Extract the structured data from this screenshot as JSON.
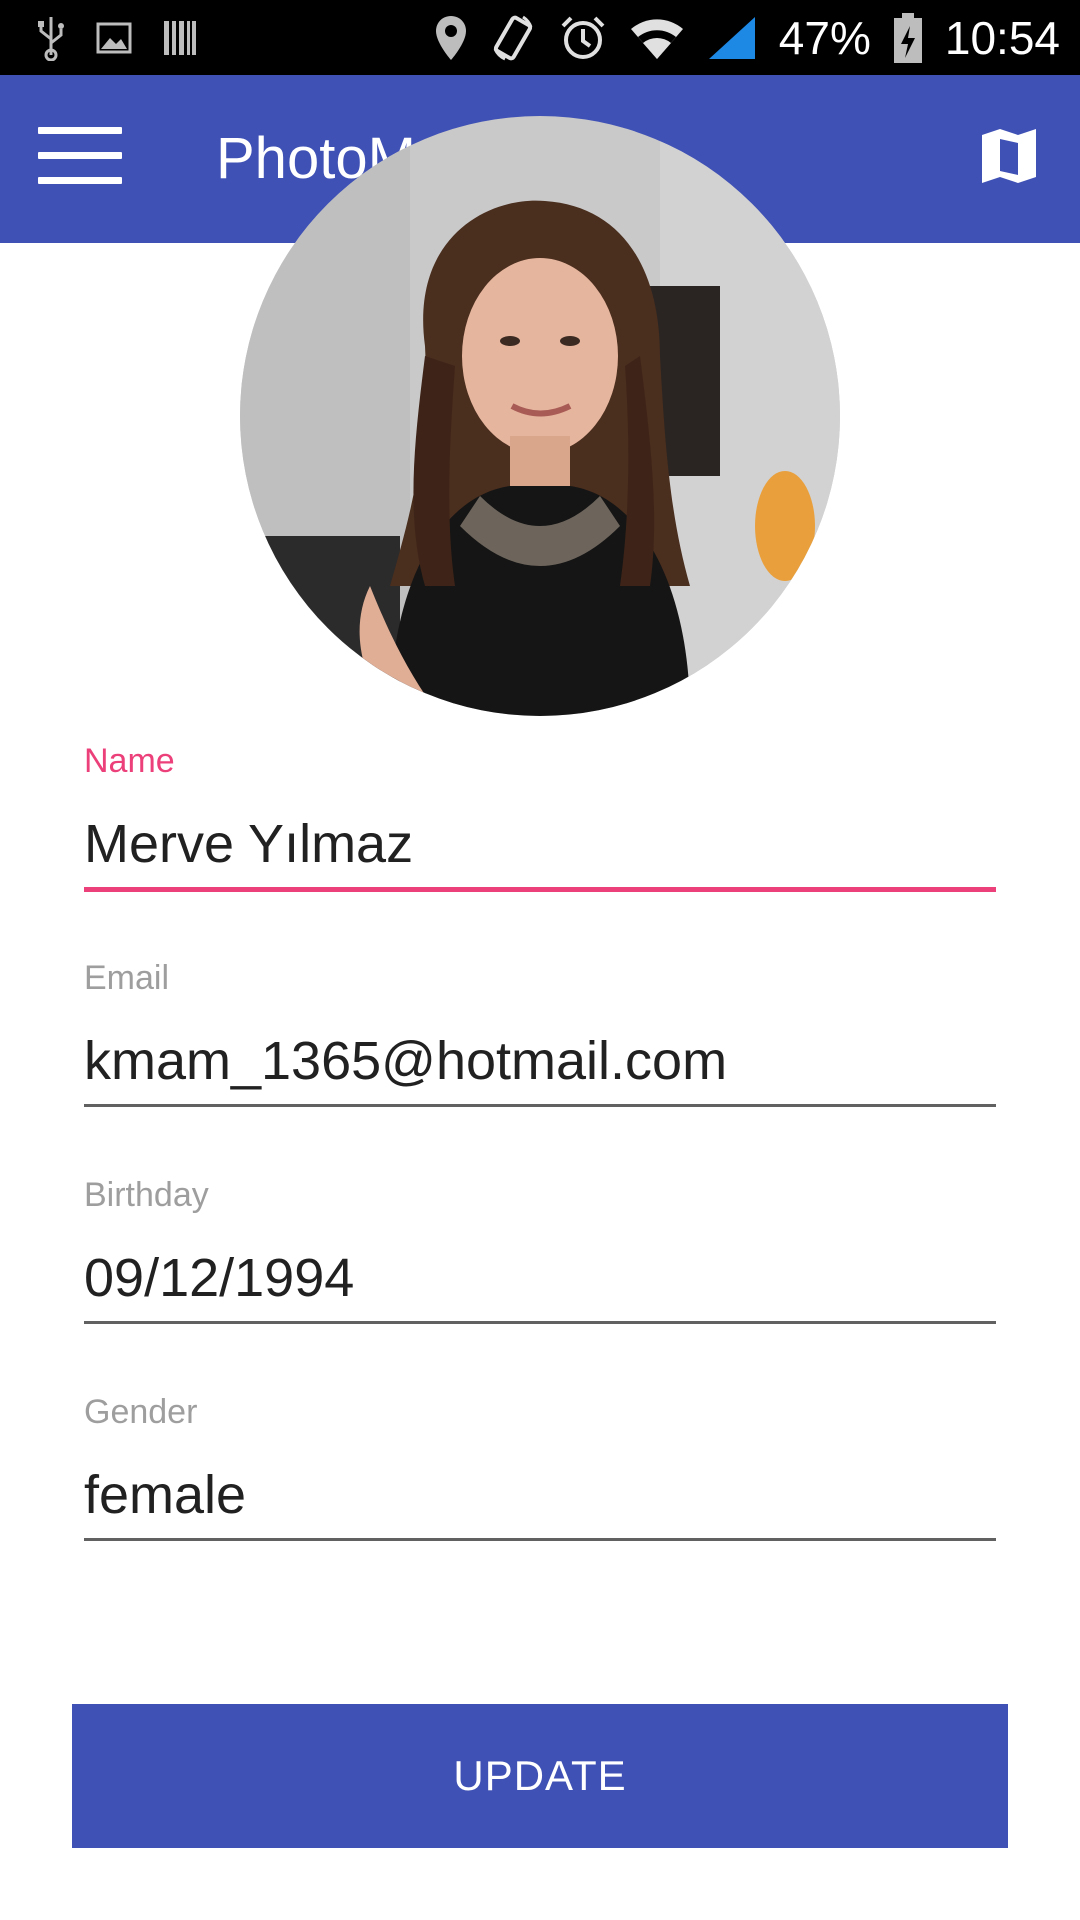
{
  "status_bar": {
    "battery_percent": "47%",
    "time": "10:54",
    "icons": [
      "usb-icon",
      "image-notification-icon",
      "barcode-icon",
      "location-pin-icon",
      "screen-rotation-icon",
      "alarm-icon",
      "wifi-icon",
      "cellular-signal-icon",
      "battery-charging-icon"
    ]
  },
  "app_bar": {
    "title": "PhotoMap",
    "menu_icon": "hamburger-menu-icon",
    "map_icon": "map-icon",
    "color": "#3f51b5"
  },
  "profile": {
    "avatar_icon": "profile-photo"
  },
  "form": {
    "fields": [
      {
        "label": "Name",
        "value": "Merve Yılmaz",
        "focused": true
      },
      {
        "label": "Email",
        "value": "kmam_1365@hotmail.com",
        "focused": false
      },
      {
        "label": "Birthday",
        "value": "09/12/1994",
        "focused": false
      },
      {
        "label": "Gender",
        "value": "female",
        "focused": false
      }
    ],
    "accent_color": "#ec407a"
  },
  "update_button": {
    "label": "UPDATE",
    "color": "#3f51b5"
  }
}
